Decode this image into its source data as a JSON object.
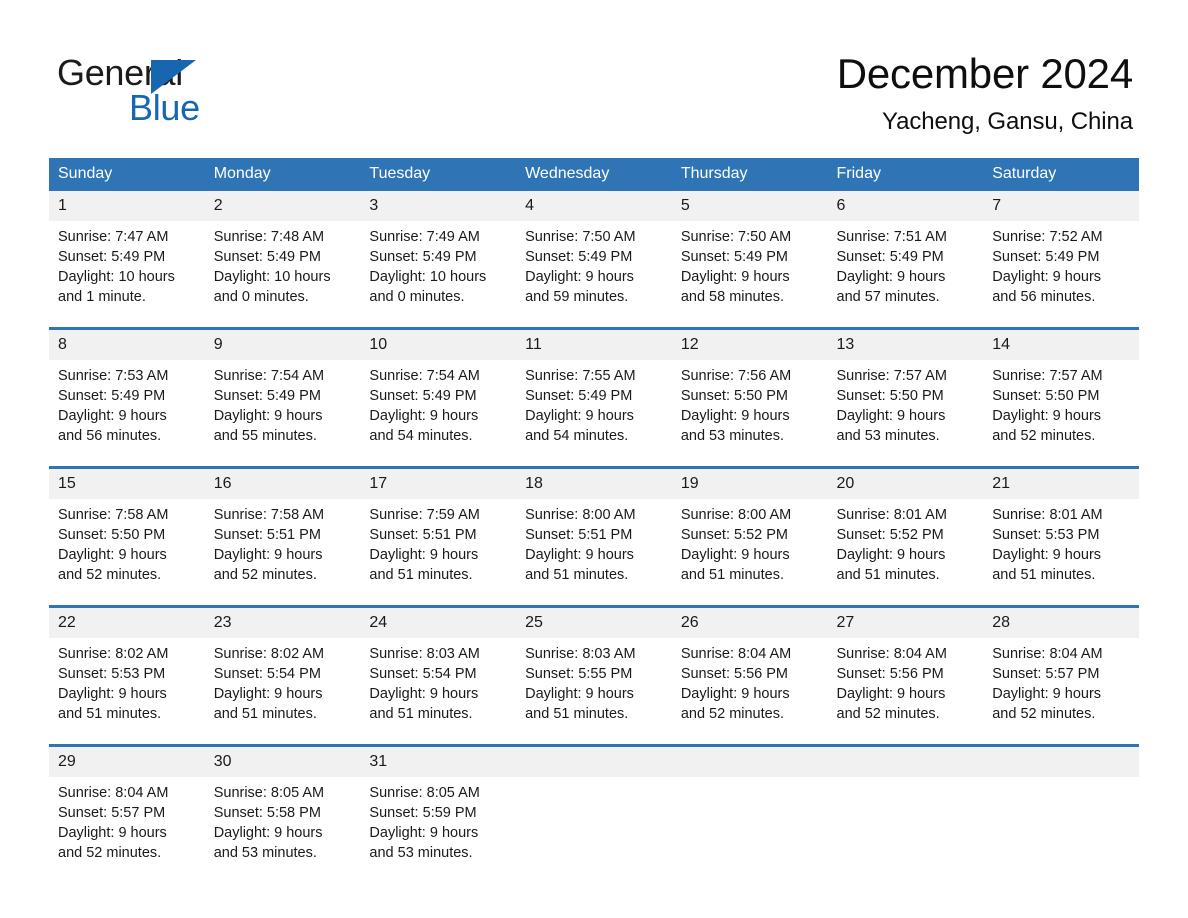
{
  "brand": {
    "name_part1": "General",
    "name_part2": "Blue",
    "accent_color": "#1767b0"
  },
  "header": {
    "title": "December 2024",
    "location": "Yacheng, Gansu, China"
  },
  "theme": {
    "header_blue": "#2f75b5",
    "daynum_bg": "#f1f1f1",
    "cell_bg": "#ffffff",
    "text": "#1a1a1a"
  },
  "calendar": {
    "day_headers": [
      "Sunday",
      "Monday",
      "Tuesday",
      "Wednesday",
      "Thursday",
      "Friday",
      "Saturday"
    ],
    "weeks": [
      {
        "days": [
          {
            "num": "1",
            "sunrise": "Sunrise: 7:47 AM",
            "sunset": "Sunset: 5:49 PM",
            "daylight1": "Daylight: 10 hours",
            "daylight2": "and 1 minute."
          },
          {
            "num": "2",
            "sunrise": "Sunrise: 7:48 AM",
            "sunset": "Sunset: 5:49 PM",
            "daylight1": "Daylight: 10 hours",
            "daylight2": "and 0 minutes."
          },
          {
            "num": "3",
            "sunrise": "Sunrise: 7:49 AM",
            "sunset": "Sunset: 5:49 PM",
            "daylight1": "Daylight: 10 hours",
            "daylight2": "and 0 minutes."
          },
          {
            "num": "4",
            "sunrise": "Sunrise: 7:50 AM",
            "sunset": "Sunset: 5:49 PM",
            "daylight1": "Daylight: 9 hours",
            "daylight2": "and 59 minutes."
          },
          {
            "num": "5",
            "sunrise": "Sunrise: 7:50 AM",
            "sunset": "Sunset: 5:49 PM",
            "daylight1": "Daylight: 9 hours",
            "daylight2": "and 58 minutes."
          },
          {
            "num": "6",
            "sunrise": "Sunrise: 7:51 AM",
            "sunset": "Sunset: 5:49 PM",
            "daylight1": "Daylight: 9 hours",
            "daylight2": "and 57 minutes."
          },
          {
            "num": "7",
            "sunrise": "Sunrise: 7:52 AM",
            "sunset": "Sunset: 5:49 PM",
            "daylight1": "Daylight: 9 hours",
            "daylight2": "and 56 minutes."
          }
        ]
      },
      {
        "days": [
          {
            "num": "8",
            "sunrise": "Sunrise: 7:53 AM",
            "sunset": "Sunset: 5:49 PM",
            "daylight1": "Daylight: 9 hours",
            "daylight2": "and 56 minutes."
          },
          {
            "num": "9",
            "sunrise": "Sunrise: 7:54 AM",
            "sunset": "Sunset: 5:49 PM",
            "daylight1": "Daylight: 9 hours",
            "daylight2": "and 55 minutes."
          },
          {
            "num": "10",
            "sunrise": "Sunrise: 7:54 AM",
            "sunset": "Sunset: 5:49 PM",
            "daylight1": "Daylight: 9 hours",
            "daylight2": "and 54 minutes."
          },
          {
            "num": "11",
            "sunrise": "Sunrise: 7:55 AM",
            "sunset": "Sunset: 5:49 PM",
            "daylight1": "Daylight: 9 hours",
            "daylight2": "and 54 minutes."
          },
          {
            "num": "12",
            "sunrise": "Sunrise: 7:56 AM",
            "sunset": "Sunset: 5:50 PM",
            "daylight1": "Daylight: 9 hours",
            "daylight2": "and 53 minutes."
          },
          {
            "num": "13",
            "sunrise": "Sunrise: 7:57 AM",
            "sunset": "Sunset: 5:50 PM",
            "daylight1": "Daylight: 9 hours",
            "daylight2": "and 53 minutes."
          },
          {
            "num": "14",
            "sunrise": "Sunrise: 7:57 AM",
            "sunset": "Sunset: 5:50 PM",
            "daylight1": "Daylight: 9 hours",
            "daylight2": "and 52 minutes."
          }
        ]
      },
      {
        "days": [
          {
            "num": "15",
            "sunrise": "Sunrise: 7:58 AM",
            "sunset": "Sunset: 5:50 PM",
            "daylight1": "Daylight: 9 hours",
            "daylight2": "and 52 minutes."
          },
          {
            "num": "16",
            "sunrise": "Sunrise: 7:58 AM",
            "sunset": "Sunset: 5:51 PM",
            "daylight1": "Daylight: 9 hours",
            "daylight2": "and 52 minutes."
          },
          {
            "num": "17",
            "sunrise": "Sunrise: 7:59 AM",
            "sunset": "Sunset: 5:51 PM",
            "daylight1": "Daylight: 9 hours",
            "daylight2": "and 51 minutes."
          },
          {
            "num": "18",
            "sunrise": "Sunrise: 8:00 AM",
            "sunset": "Sunset: 5:51 PM",
            "daylight1": "Daylight: 9 hours",
            "daylight2": "and 51 minutes."
          },
          {
            "num": "19",
            "sunrise": "Sunrise: 8:00 AM",
            "sunset": "Sunset: 5:52 PM",
            "daylight1": "Daylight: 9 hours",
            "daylight2": "and 51 minutes."
          },
          {
            "num": "20",
            "sunrise": "Sunrise: 8:01 AM",
            "sunset": "Sunset: 5:52 PM",
            "daylight1": "Daylight: 9 hours",
            "daylight2": "and 51 minutes."
          },
          {
            "num": "21",
            "sunrise": "Sunrise: 8:01 AM",
            "sunset": "Sunset: 5:53 PM",
            "daylight1": "Daylight: 9 hours",
            "daylight2": "and 51 minutes."
          }
        ]
      },
      {
        "days": [
          {
            "num": "22",
            "sunrise": "Sunrise: 8:02 AM",
            "sunset": "Sunset: 5:53 PM",
            "daylight1": "Daylight: 9 hours",
            "daylight2": "and 51 minutes."
          },
          {
            "num": "23",
            "sunrise": "Sunrise: 8:02 AM",
            "sunset": "Sunset: 5:54 PM",
            "daylight1": "Daylight: 9 hours",
            "daylight2": "and 51 minutes."
          },
          {
            "num": "24",
            "sunrise": "Sunrise: 8:03 AM",
            "sunset": "Sunset: 5:54 PM",
            "daylight1": "Daylight: 9 hours",
            "daylight2": "and 51 minutes."
          },
          {
            "num": "25",
            "sunrise": "Sunrise: 8:03 AM",
            "sunset": "Sunset: 5:55 PM",
            "daylight1": "Daylight: 9 hours",
            "daylight2": "and 51 minutes."
          },
          {
            "num": "26",
            "sunrise": "Sunrise: 8:04 AM",
            "sunset": "Sunset: 5:56 PM",
            "daylight1": "Daylight: 9 hours",
            "daylight2": "and 52 minutes."
          },
          {
            "num": "27",
            "sunrise": "Sunrise: 8:04 AM",
            "sunset": "Sunset: 5:56 PM",
            "daylight1": "Daylight: 9 hours",
            "daylight2": "and 52 minutes."
          },
          {
            "num": "28",
            "sunrise": "Sunrise: 8:04 AM",
            "sunset": "Sunset: 5:57 PM",
            "daylight1": "Daylight: 9 hours",
            "daylight2": "and 52 minutes."
          }
        ]
      },
      {
        "days": [
          {
            "num": "29",
            "sunrise": "Sunrise: 8:04 AM",
            "sunset": "Sunset: 5:57 PM",
            "daylight1": "Daylight: 9 hours",
            "daylight2": "and 52 minutes."
          },
          {
            "num": "30",
            "sunrise": "Sunrise: 8:05 AM",
            "sunset": "Sunset: 5:58 PM",
            "daylight1": "Daylight: 9 hours",
            "daylight2": "and 53 minutes."
          },
          {
            "num": "31",
            "sunrise": "Sunrise: 8:05 AM",
            "sunset": "Sunset: 5:59 PM",
            "daylight1": "Daylight: 9 hours",
            "daylight2": "and 53 minutes."
          },
          {
            "num": "",
            "sunrise": "",
            "sunset": "",
            "daylight1": "",
            "daylight2": ""
          },
          {
            "num": "",
            "sunrise": "",
            "sunset": "",
            "daylight1": "",
            "daylight2": ""
          },
          {
            "num": "",
            "sunrise": "",
            "sunset": "",
            "daylight1": "",
            "daylight2": ""
          },
          {
            "num": "",
            "sunrise": "",
            "sunset": "",
            "daylight1": "",
            "daylight2": ""
          }
        ]
      }
    ]
  }
}
